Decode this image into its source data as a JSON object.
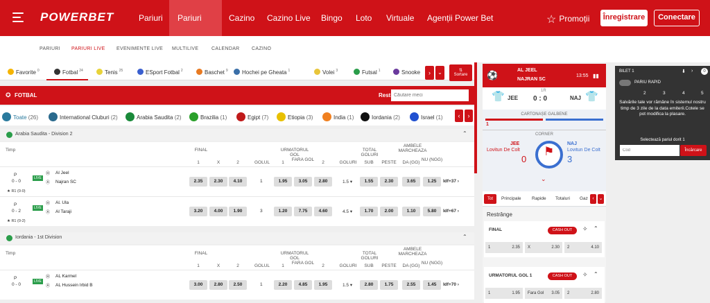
{
  "header": {
    "logo": "POWERBET",
    "nav": [
      "Pariuri",
      "Pariuri Live",
      "Cazino",
      "Cazino Live",
      "Bingo",
      "Loto",
      "Virtuale",
      "Agenții Power Bet"
    ],
    "promo": "Promoții",
    "register": "Înregistrare",
    "login": "Conectare"
  },
  "subnav": [
    "PARIURI",
    "PARIURI LIVE",
    "EVENIMENTE LIVE",
    "MULTILIVE",
    "CALENDAR",
    "CAZINO"
  ],
  "sports": [
    {
      "label": "Favorite",
      "count": "0",
      "color": "#f5b400"
    },
    {
      "label": "Fotbal",
      "count": "24",
      "color": "#333"
    },
    {
      "label": "Tenis",
      "count": "25",
      "color": "#e8d33a"
    },
    {
      "label": "ESport Fotbal",
      "count": "2",
      "color": "#3a5fcf"
    },
    {
      "label": "Baschet",
      "count": "9",
      "color": "#e87a22"
    },
    {
      "label": "Hochei pe Gheata",
      "count": "1",
      "color": "#3a6fa8"
    },
    {
      "label": "Volei",
      "count": "3",
      "color": "#e8c53a"
    },
    {
      "label": "Futsal",
      "count": "1",
      "color": "#2a9d4a"
    },
    {
      "label": "Snooke",
      "count": "",
      "color": "#6a3a9d"
    }
  ],
  "sort_label": "Sortare",
  "fotbal_header": {
    "title": "FOTBAL",
    "restrange": "Restrânge",
    "search_placeholder": "Căutare meci"
  },
  "countries": [
    {
      "label": "Toate",
      "count": "(26)",
      "color": "#2a7a9d"
    },
    {
      "label": "International Cluburi",
      "count": "(2)",
      "color": "#2a6a8d"
    },
    {
      "label": "Arabia Saudita",
      "count": "(2)",
      "color": "#1a8a3a"
    },
    {
      "label": "Brazilia",
      "count": "(1)",
      "color": "#2aa02a"
    },
    {
      "label": "Egipt",
      "count": "(7)",
      "color": "#c01a1a"
    },
    {
      "label": "Etiopia",
      "count": "(3)",
      "color": "#e8c000"
    },
    {
      "label": "India",
      "count": "(1)",
      "color": "#f08020"
    },
    {
      "label": "Iordania",
      "count": "(2)",
      "color": "#111"
    },
    {
      "label": "Israel",
      "count": "(1)",
      "color": "#2050d0"
    }
  ],
  "leagues": [
    {
      "name": "Arabia Saudita - Division 2",
      "headers": {
        "timp": "Timp",
        "final": "FINAL",
        "urm": "URMATORUL GOL",
        "total": "TOTAL GOLURI",
        "ambele": "AMBELE MARCHEAZA",
        "h1": "1",
        "hx": "X",
        "h2": "2",
        "golul": "GOLUL",
        "u1": "1",
        "fara": "FARA GOL",
        "u2": "2",
        "goluri": "GOLURI",
        "sub": "SUB",
        "peste": "PESTE",
        "da": "DA (GG)",
        "nu": "NU (NGG)"
      },
      "matches": [
        {
          "period": "P",
          "score": "0 - 0",
          "live": "LIVE",
          "home": "Al Jeel",
          "away": "Najran SC",
          "r1": "R1 (0-0)",
          "odds": [
            "2.35",
            "2.30",
            "4.10"
          ],
          "golul": "1",
          "next": [
            "1.95",
            "3.05",
            "2.80"
          ],
          "line": "1.5",
          "total": [
            "1.55",
            "2.30"
          ],
          "gg": [
            "3.65",
            "1.25"
          ],
          "more": "Idf+37"
        },
        {
          "period": "P",
          "score": "0 - 2",
          "live": "LIVE",
          "home": "Al. Ula",
          "away": "Al Taraji",
          "r1": "R1 (0-2)",
          "odds": [
            "3.20",
            "4.00",
            "1.90"
          ],
          "golul": "3",
          "next": [
            "1.20",
            "7.75",
            "4.60"
          ],
          "line": "4.5",
          "total": [
            "1.70",
            "2.00"
          ],
          "gg": [
            "1.10",
            "5.80"
          ],
          "more": "Idf+67"
        }
      ]
    },
    {
      "name": "Iordania - 1st Division",
      "matches": [
        {
          "period": "P",
          "score": "0 - 0",
          "live": "LIVE",
          "home": "AL Karmel",
          "away": "AL Hussein Irbid B",
          "odds": [
            "3.00",
            "2.80",
            "2.50"
          ],
          "golul": "1",
          "next": [
            "2.20",
            "4.85",
            "1.95"
          ],
          "line": "1.5",
          "total": [
            "2.80",
            "1.75"
          ],
          "gg": [
            "2.55",
            "1.45"
          ],
          "more": "Idf+70"
        }
      ]
    }
  ],
  "live": {
    "home": "AL JEEL",
    "away": "NAJRAN SC",
    "time": "13:55",
    "ht": "1R",
    "score": "0 : 0",
    "home_short": "JEE",
    "away_short": "NAJ",
    "card_title": "CARTONAȘE GALBENE",
    "card_home": "1",
    "corner": "CORNER",
    "home_player": "Lovitun De Colt",
    "away_player": "Lovitun De Colt",
    "home_corner": "0",
    "away_corner": "3",
    "team_home_code": "JEE",
    "team_away_code": "NAJ",
    "tabs": [
      "Tot",
      "Principale",
      "Rapide",
      "Totaluri",
      "Gaz"
    ],
    "restrange": "Restrânge",
    "markets": [
      {
        "title": "FINAL",
        "cashout": "CASH OUT",
        "odds": [
          [
            "1",
            "2.35"
          ],
          [
            "X",
            "2.30"
          ],
          [
            "2",
            "4.10"
          ]
        ]
      },
      {
        "title": "URMATORUL GOL 1",
        "cashout": "CASH OUT",
        "odds": [
          [
            "1",
            "1.95"
          ],
          [
            "Fara Gol",
            "3.05"
          ],
          [
            "2",
            "2.80"
          ]
        ]
      }
    ]
  },
  "betslip": {
    "title": "BILET 1",
    "count": "0",
    "rapid": "PARIU RAPID",
    "nums": [
      "2",
      "3",
      "4",
      "5"
    ],
    "msg": "Salvările tale vor rămâne în sistemul nostru timp de 3 zile de la data emiterii.Cotele se pot modifica la plasare.",
    "select": "Selectează pariul dorit 1",
    "code_placeholder": "Cod",
    "load": "Încărcare"
  }
}
